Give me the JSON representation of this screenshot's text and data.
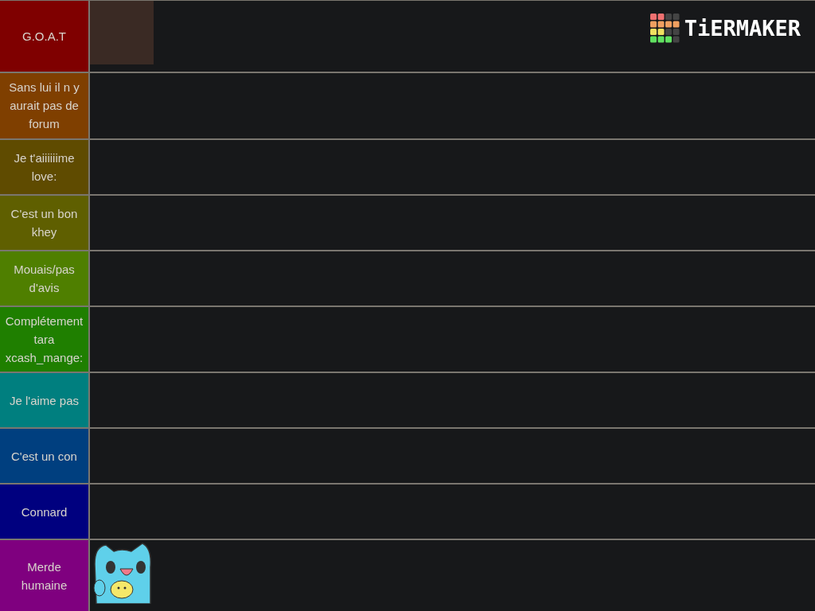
{
  "logo": {
    "text": "TiERMAKER"
  },
  "tiers": [
    {
      "label": "G.O.A.T",
      "color": "#7f0000",
      "items": [
        {
          "kind": "photo"
        }
      ]
    },
    {
      "label": "Sans lui il n y aurait pas de forum",
      "color": "#7f3f00"
    },
    {
      "label": "Je t'aiiiiiime love:",
      "color": "#5f4b00"
    },
    {
      "label": "C'est un bon khey",
      "color": "#5f5f00"
    },
    {
      "label": "Mouais/pas d'avis",
      "color": "#4f7f00"
    },
    {
      "label": "Complétement tara xcash_mange:",
      "color": "#1f7f00"
    },
    {
      "label": "Je l'aime pas",
      "color": "#007f7f"
    },
    {
      "label": "C'est un con",
      "color": "#003f7f"
    },
    {
      "label": "Connard",
      "color": "#00007f"
    },
    {
      "label": "Merde humaine",
      "color": "#7f007f",
      "items": [
        {
          "kind": "sticker"
        }
      ]
    }
  ]
}
